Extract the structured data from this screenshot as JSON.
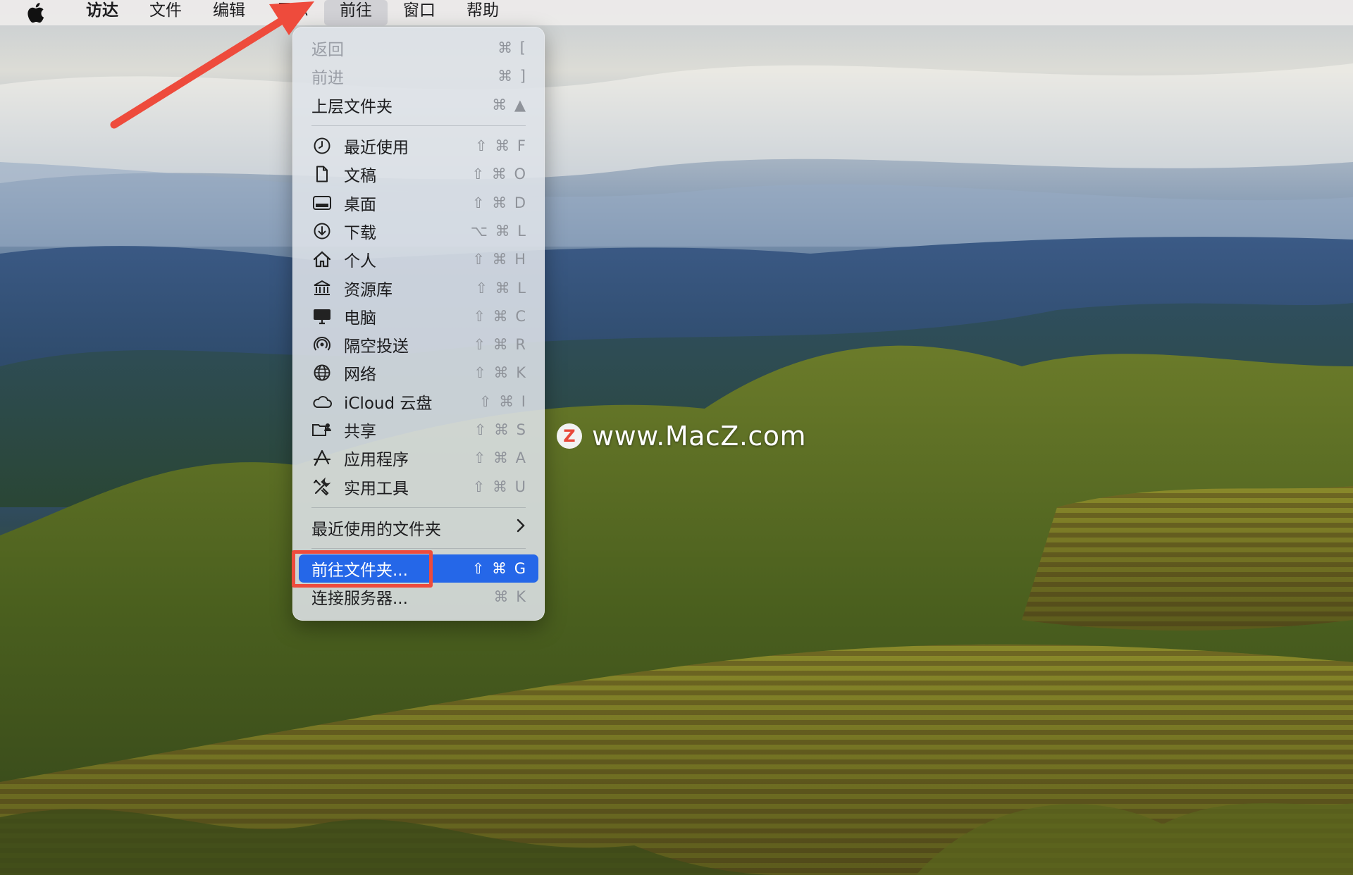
{
  "menubar": {
    "items": [
      {
        "label": "访达",
        "bold": true
      },
      {
        "label": "文件"
      },
      {
        "label": "编辑"
      },
      {
        "label": "显示"
      },
      {
        "label": "前往",
        "active": true
      },
      {
        "label": "窗口"
      },
      {
        "label": "帮助"
      }
    ]
  },
  "go_menu": {
    "back": {
      "label": "返回",
      "shortcut": "⌘ ["
    },
    "forward": {
      "label": "前进",
      "shortcut": "⌘ ]"
    },
    "enclosing": {
      "label": "上层文件夹",
      "shortcut": "⌘ ▲"
    },
    "places": [
      {
        "label": "最近使用",
        "shortcut": "⇧ ⌘ F",
        "icon": "clock-icon"
      },
      {
        "label": "文稿",
        "shortcut": "⇧ ⌘ O",
        "icon": "document-icon"
      },
      {
        "label": "桌面",
        "shortcut": "⇧ ⌘ D",
        "icon": "desktop-icon"
      },
      {
        "label": "下载",
        "shortcut": "⌥ ⌘ L",
        "icon": "download-icon"
      },
      {
        "label": "个人",
        "shortcut": "⇧ ⌘ H",
        "icon": "home-icon"
      },
      {
        "label": "资源库",
        "shortcut": "⇧ ⌘ L",
        "icon": "library-icon"
      },
      {
        "label": "电脑",
        "shortcut": "⇧ ⌘ C",
        "icon": "computer-icon"
      },
      {
        "label": "隔空投送",
        "shortcut": "⇧ ⌘ R",
        "icon": "airdrop-icon"
      },
      {
        "label": "网络",
        "shortcut": "⇧ ⌘ K",
        "icon": "network-icon"
      },
      {
        "label": "iCloud 云盘",
        "shortcut": "⇧ ⌘ I",
        "icon": "cloud-icon"
      },
      {
        "label": "共享",
        "shortcut": "⇧ ⌘ S",
        "icon": "shared-folder-icon"
      },
      {
        "label": "应用程序",
        "shortcut": "⇧ ⌘ A",
        "icon": "apps-icon"
      },
      {
        "label": "实用工具",
        "shortcut": "⇧ ⌘ U",
        "icon": "tools-icon"
      }
    ],
    "recent_folders": {
      "label": "最近使用的文件夹"
    },
    "go_to_folder": {
      "label": "前往文件夹...",
      "shortcut": "⇧ ⌘ G"
    },
    "connect_server": {
      "label": "连接服务器...",
      "shortcut": "⌘ K"
    }
  },
  "watermark": {
    "text": "www.MacZ.com",
    "logo_letter": "Z"
  },
  "colors": {
    "selection": "#2567e8",
    "annotation_red": "#ee4b3c"
  }
}
